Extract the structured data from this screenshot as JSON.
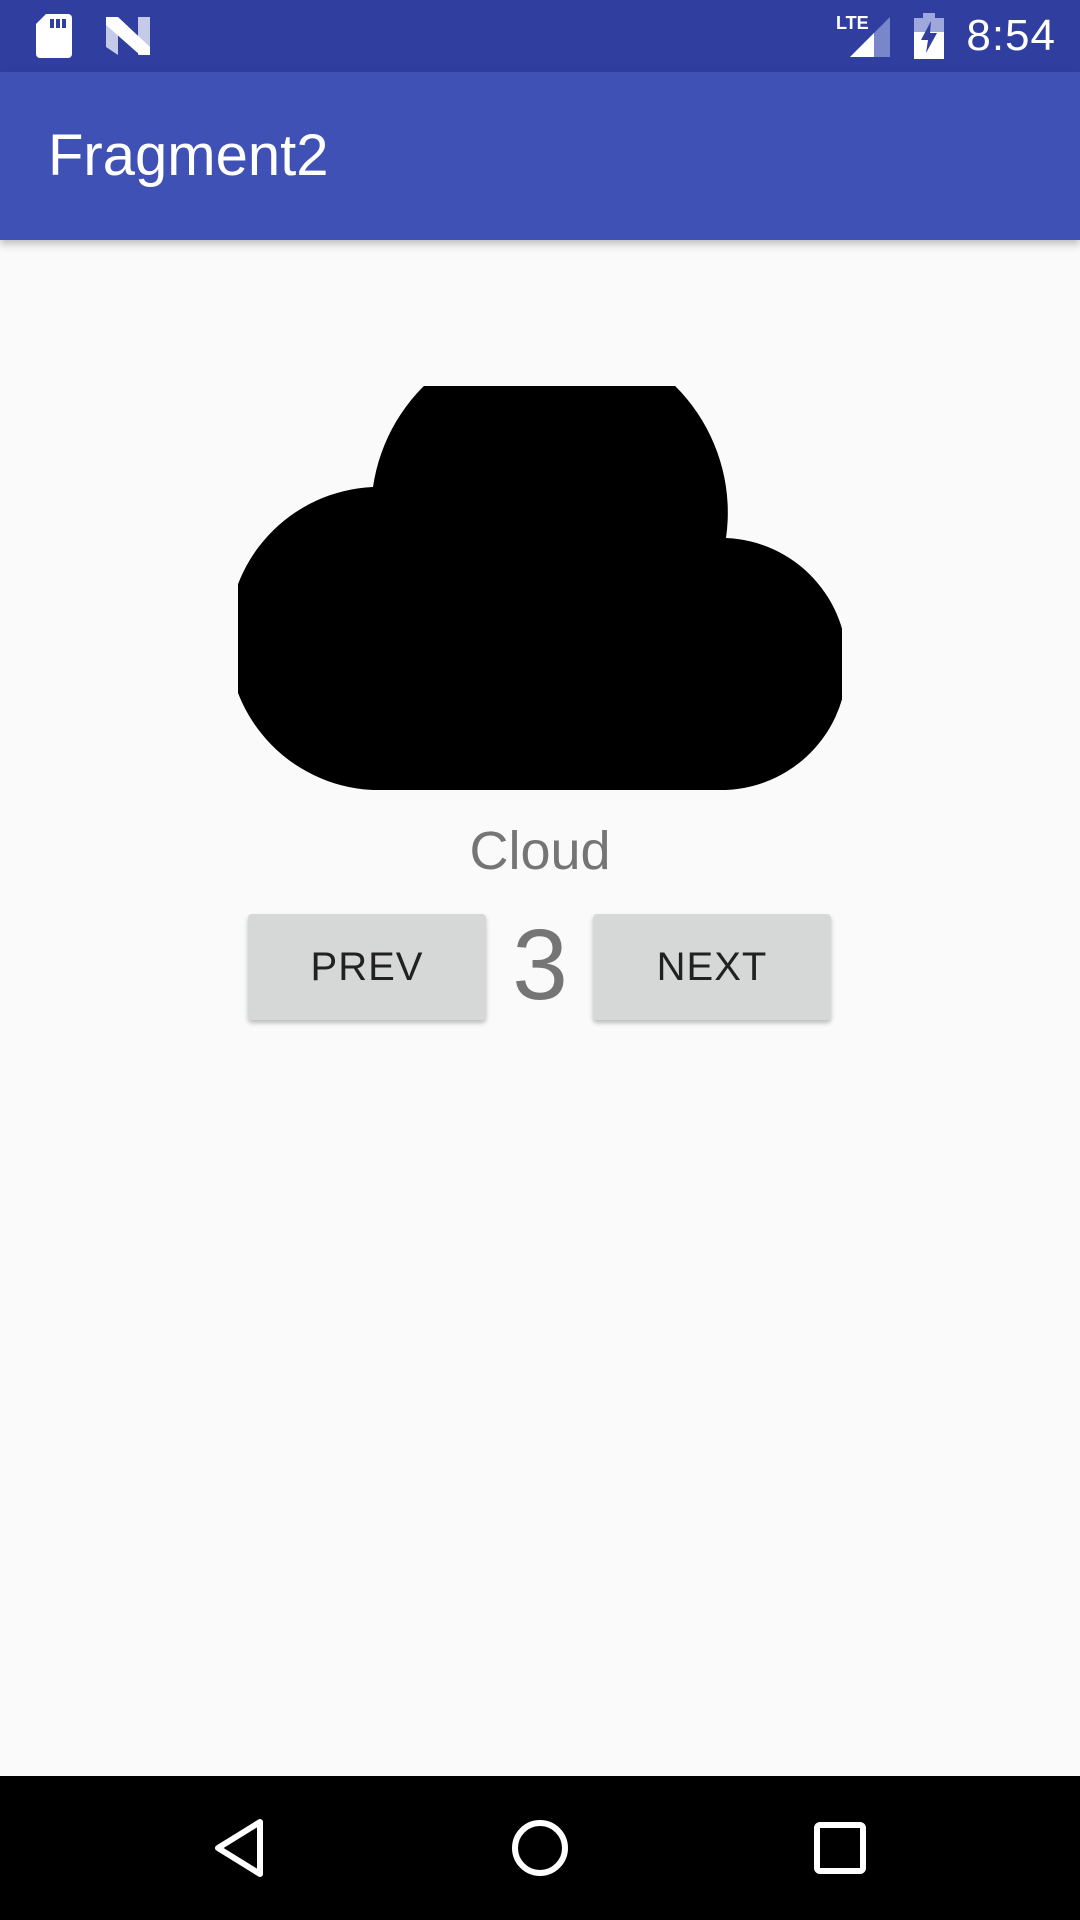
{
  "status_bar": {
    "time": "8:54",
    "network_label": "LTE",
    "icons": [
      "sd-card-icon",
      "n-logo-icon",
      "lte-signal-icon",
      "battery-charging-icon"
    ],
    "background": "#303f9f"
  },
  "app_bar": {
    "title": "Fragment2",
    "background": "#3f51b5"
  },
  "content": {
    "image_icon": "cloud-icon",
    "item_name": "Cloud",
    "counter": "3",
    "prev_label": "PREV",
    "next_label": "NEXT"
  },
  "nav_bar": {
    "icons": [
      "back-icon",
      "home-icon",
      "recents-icon"
    ]
  }
}
